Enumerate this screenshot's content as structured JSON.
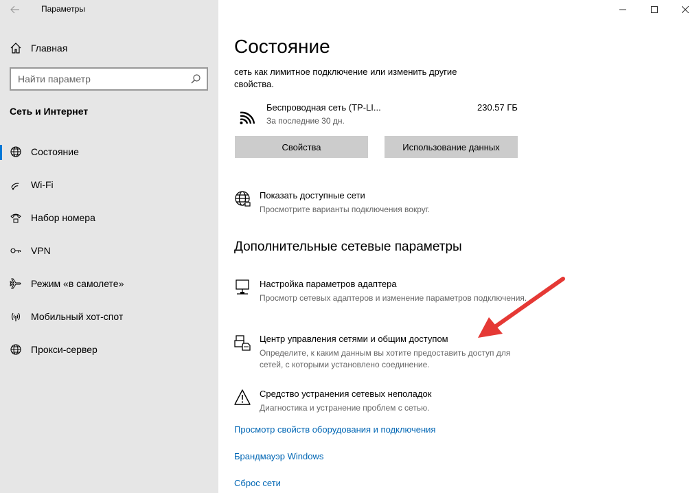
{
  "window": {
    "title": "Параметры",
    "controls": {
      "minimize": "—",
      "maximize": "☐",
      "close": "✕"
    }
  },
  "sidebar": {
    "home_label": "Главная",
    "search_placeholder": "Найти параметр",
    "section_title": "Сеть и Интернет",
    "items": [
      {
        "label": "Состояние",
        "icon": "globe-icon",
        "active": true
      },
      {
        "label": "Wi-Fi",
        "icon": "wifi-icon",
        "active": false
      },
      {
        "label": "Набор номера",
        "icon": "dialup-icon",
        "active": false
      },
      {
        "label": "VPN",
        "icon": "vpn-icon",
        "active": false
      },
      {
        "label": "Режим «в самолете»",
        "icon": "airplane-icon",
        "active": false
      },
      {
        "label": "Мобильный хот-спот",
        "icon": "hotspot-icon",
        "active": false
      },
      {
        "label": "Прокси-сервер",
        "icon": "globe-icon",
        "active": false
      }
    ]
  },
  "main": {
    "title": "Состояние",
    "description": "сеть как лимитное подключение или изменить другие свойства.",
    "network": {
      "name": "Беспроводная сеть (TP-LI...",
      "period": "За последние 30 дн.",
      "usage": "230.57 ГБ"
    },
    "buttons": {
      "properties": "Свойства",
      "data_usage": "Использование данных"
    },
    "show_networks": {
      "title": "Показать доступные сети",
      "subtitle": "Просмотрите варианты подключения вокруг."
    },
    "advanced_heading": "Дополнительные сетевые параметры",
    "advanced_items": [
      {
        "title": "Настройка параметров адаптера",
        "subtitle": "Просмотр сетевых адаптеров и изменение параметров подключения.",
        "icon": "adapter-icon"
      },
      {
        "title": "Центр управления сетями и общим доступом",
        "subtitle": "Определите, к каким данным вы хотите предоставить доступ для сетей, с которыми установлено соединение.",
        "icon": "sharing-center-icon"
      },
      {
        "title": "Средство устранения сетевых неполадок",
        "subtitle": "Диагностика и устранение проблем с сетью.",
        "icon": "warning-icon"
      }
    ],
    "links": [
      "Просмотр свойств оборудования и подключения",
      "Брандмауэр Windows",
      "Сброс сети"
    ]
  },
  "colors": {
    "sidebar_bg": "#e6e6e6",
    "accent": "#0078d7",
    "link": "#0066b4",
    "button_bg": "#cccccc",
    "annotation_arrow": "#e53935"
  }
}
